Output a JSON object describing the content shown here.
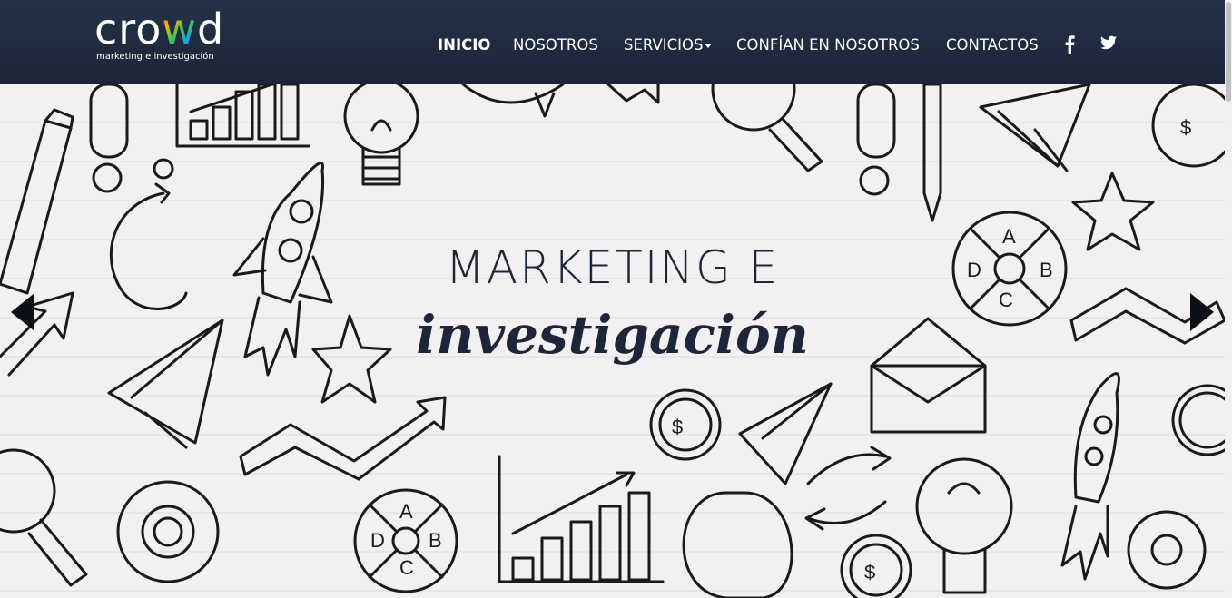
{
  "brand": {
    "name_part1": "cro",
    "name_w": "w",
    "name_part2": "d",
    "tagline": "marketing e investigación"
  },
  "nav": {
    "items": [
      {
        "label": "INICIO",
        "active": true
      },
      {
        "label": "NOSOTROS"
      },
      {
        "label": "SERVICIOS",
        "has_dropdown": true
      },
      {
        "label": "CONFÍAN EN NOSOTROS"
      },
      {
        "label": "CONTACTOS"
      }
    ],
    "social": [
      "facebook-icon",
      "twitter-icon"
    ]
  },
  "hero": {
    "title": "MARKETING E",
    "subtitle": "investigación",
    "prev_icon": "chevron-left-icon",
    "next_icon": "chevron-right-icon"
  },
  "colors": {
    "navbar": "#1f2b40",
    "nav_text": "#ffffff",
    "hero_text": "#1d2638",
    "hero_background": "#f2f0f0"
  }
}
